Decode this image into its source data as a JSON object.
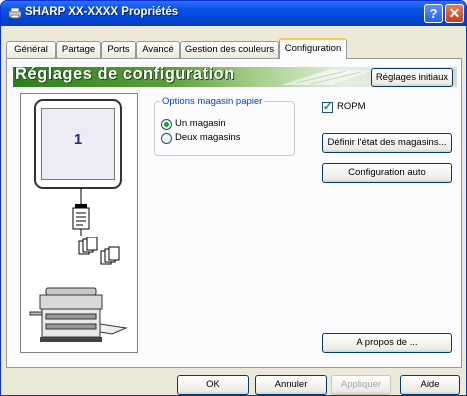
{
  "window": {
    "title": "SHARP XX-XXXX Propriétés",
    "help_label": "?",
    "close_label": "✕"
  },
  "tabs": [
    {
      "label": "Général"
    },
    {
      "label": "Partage"
    },
    {
      "label": "Ports"
    },
    {
      "label": "Avancé"
    },
    {
      "label": "Gestion des couleurs"
    },
    {
      "label": "Configuration",
      "active": true
    }
  ],
  "banner": {
    "title": "Réglages de configuration",
    "reset_label": "Réglages initiaux"
  },
  "preview": {
    "tray_count_label": "1"
  },
  "tray_options": {
    "legend": "Options magasin papier",
    "options": [
      {
        "label": "Un magasin",
        "checked": true
      },
      {
        "label": "Deux magasins",
        "checked": false
      }
    ]
  },
  "ropm": {
    "label": "ROPM",
    "checked": true
  },
  "buttons": {
    "define_trays": "Définir l'état des magasins...",
    "auto_config": "Configuration auto",
    "about": "A propos de ..."
  },
  "footer": {
    "ok": "OK",
    "cancel": "Annuler",
    "apply": "Appliquer",
    "help": "Aide"
  },
  "colors": {
    "titlebar": "#0a55e6",
    "banner_green": "#3f8a2a",
    "accent_orange": "#ffc83c"
  }
}
